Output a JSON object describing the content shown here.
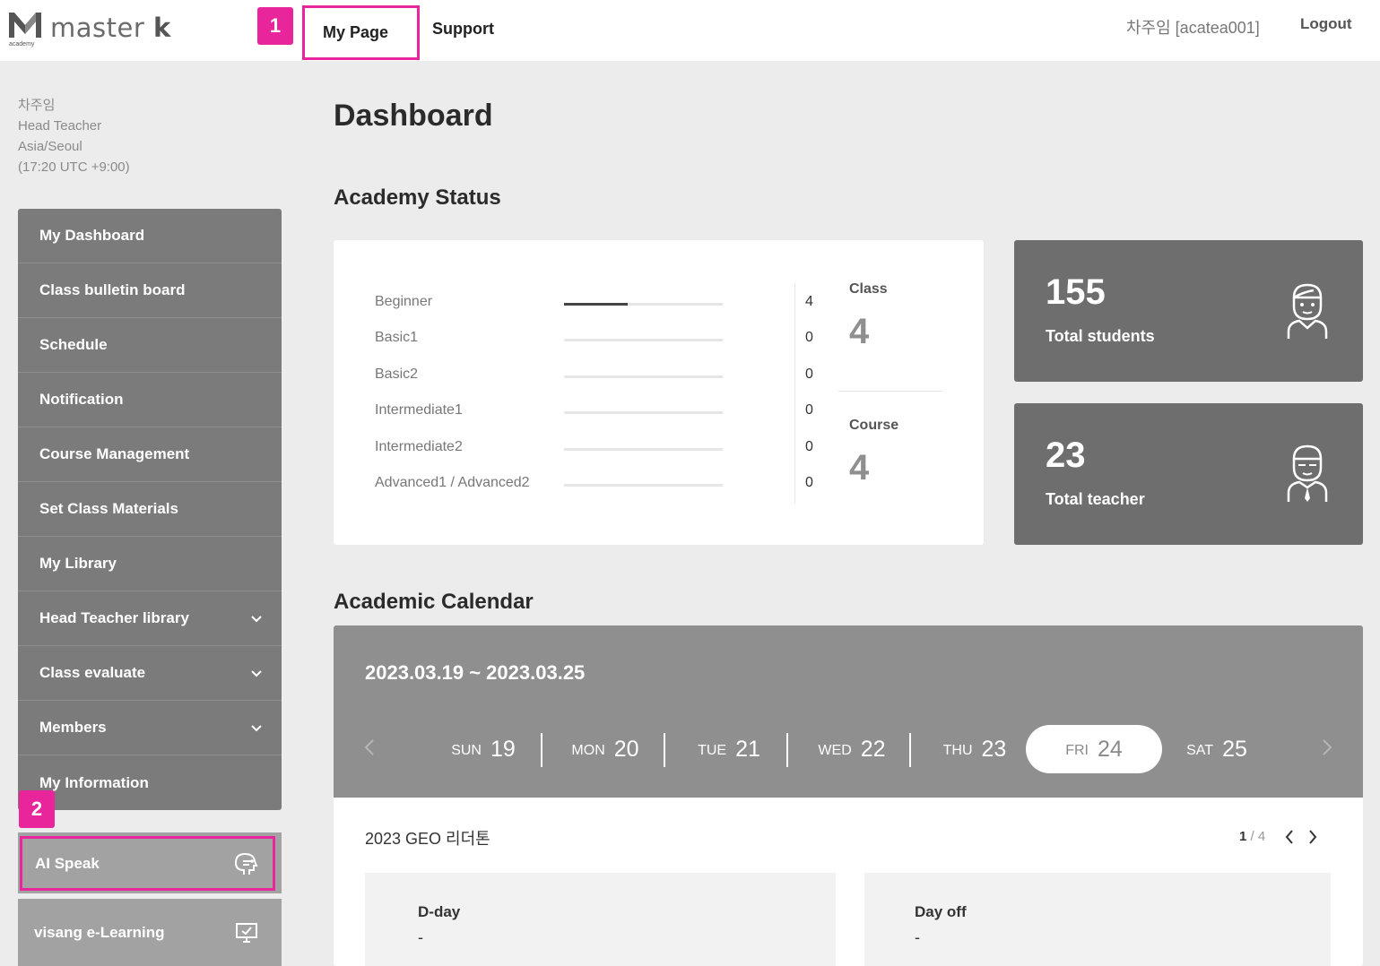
{
  "header": {
    "logo_text": "master",
    "logo_k": "k",
    "logo_sub": "academy",
    "nav": [
      "My Page",
      "Support"
    ],
    "user_label": "차주임 [acatea001]",
    "logout_label": "Logout",
    "highlight_color": "#e8259a"
  },
  "annotations": [
    "1",
    "2"
  ],
  "profile": {
    "name": "차주임",
    "role": "Head Teacher",
    "timezone": "Asia/Seoul",
    "time": "(17:20 UTC +9:00)"
  },
  "sidebar": {
    "items": [
      {
        "label": "My Dashboard",
        "icon": ""
      },
      {
        "label": "Class bulletin board",
        "icon": ""
      },
      {
        "label": "Schedule",
        "icon": ""
      },
      {
        "label": "Notification",
        "icon": ""
      },
      {
        "label": "Course Management",
        "icon": ""
      },
      {
        "label": "Set Class Materials",
        "icon": ""
      },
      {
        "label": "My Library",
        "icon": ""
      },
      {
        "label": "Head Teacher library",
        "icon": "chevron-down-icon"
      },
      {
        "label": "Class evaluate",
        "icon": "chevron-down-icon"
      },
      {
        "label": "Members",
        "icon": "chevron-down-icon"
      },
      {
        "label": "My Information",
        "icon": ""
      }
    ],
    "ai_speak_label": "AI Speak",
    "elearning_label": "visang e-Learning"
  },
  "main": {
    "title": "Dashboard",
    "academy_status_title": "Academy Status",
    "levels": [
      {
        "name": "Beginner",
        "count": "4",
        "fill": 0.4
      },
      {
        "name": "Basic1",
        "count": "0",
        "fill": 0
      },
      {
        "name": "Basic2",
        "count": "0",
        "fill": 0
      },
      {
        "name": "Intermediate1",
        "count": "0",
        "fill": 0
      },
      {
        "name": "Intermediate2",
        "count": "0",
        "fill": 0
      },
      {
        "name": "Advanced1 / Advanced2",
        "count": "0",
        "fill": 0
      }
    ],
    "class_label": "Class",
    "class_value": "4",
    "course_label": "Course",
    "course_value": "4",
    "total_students_value": "155",
    "total_students_label": "Total students",
    "total_teacher_value": "23",
    "total_teacher_label": "Total teacher"
  },
  "calendar": {
    "title": "Academic Calendar",
    "range": "2023.03.19 ~ 2023.03.25",
    "days": [
      {
        "name": "SUN",
        "date": "19",
        "selected": false
      },
      {
        "name": "MON",
        "date": "20",
        "selected": false
      },
      {
        "name": "TUE",
        "date": "21",
        "selected": false
      },
      {
        "name": "WED",
        "date": "22",
        "selected": false
      },
      {
        "name": "THU",
        "date": "23",
        "selected": false
      },
      {
        "name": "FRI",
        "date": "24",
        "selected": true
      },
      {
        "name": "SAT",
        "date": "25",
        "selected": false
      }
    ],
    "event_title": "2023 GEO 리더톤",
    "page_current": "1",
    "page_sep": " / ",
    "page_total": "4",
    "dday_label": "D-day",
    "dday_value": "-",
    "dayoff_label": "Day off",
    "dayoff_value": "-"
  }
}
